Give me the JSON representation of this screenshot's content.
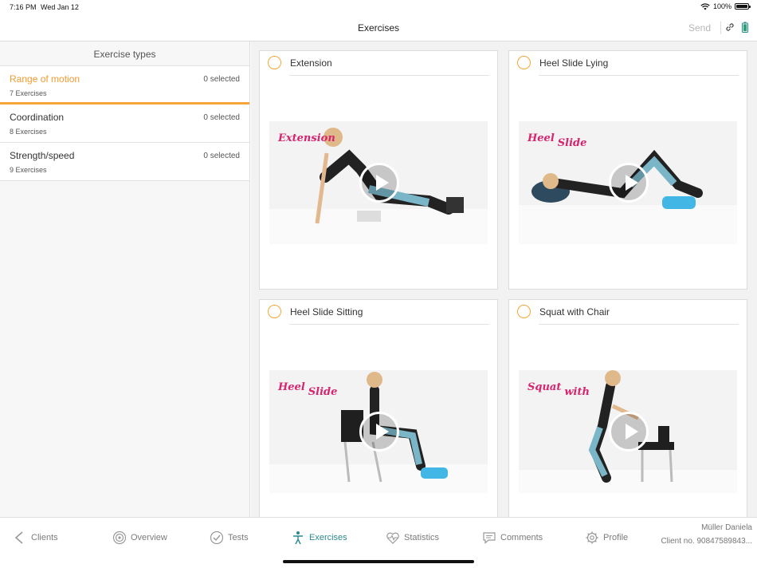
{
  "status_bar": {
    "time": "7:16 PM",
    "date": "Wed Jan 12",
    "battery_pct": "100%"
  },
  "nav": {
    "title": "Exercises",
    "send_label": "Send",
    "icons": [
      "link-icon",
      "battery-icon"
    ]
  },
  "sidebar": {
    "header": "Exercise types",
    "types": [
      {
        "name": "Range of motion",
        "count": "7 Exercises",
        "selected": "0 selected",
        "active": true
      },
      {
        "name": "Coordination",
        "count": "8 Exercises",
        "selected": "0 selected",
        "active": false
      },
      {
        "name": "Strength/speed",
        "count": "9 Exercises",
        "selected": "0 selected",
        "active": false
      }
    ]
  },
  "exercises": [
    {
      "title": "Extension",
      "overlay": "Extension",
      "overlay_sub": ""
    },
    {
      "title": "Heel Slide Lying",
      "overlay": "Heel",
      "overlay_sub": "Slide"
    },
    {
      "title": "Heel Slide Sitting",
      "overlay": "Heel",
      "overlay_sub": "Slide"
    },
    {
      "title": "Squat with Chair",
      "overlay": "Squat",
      "overlay_sub": "with"
    }
  ],
  "tabs": [
    {
      "label": "Clients",
      "icon": "chevron-left-icon"
    },
    {
      "label": "Overview",
      "icon": "spiral-icon"
    },
    {
      "label": "Tests",
      "icon": "check-circle-icon"
    },
    {
      "label": "Exercises",
      "icon": "figure-icon",
      "active": true
    },
    {
      "label": "Statistics",
      "icon": "heart-pulse-icon"
    },
    {
      "label": "Comments",
      "icon": "speech-bubble-icon"
    },
    {
      "label": "Profile",
      "icon": "gear-icon"
    }
  ],
  "client": {
    "name": "Müller Daniela",
    "number": "Client no. 90847589843..."
  },
  "colors": {
    "accent": "#f5a53a",
    "active_tab": "#2a8a8e",
    "overlay_text": "#d6246e"
  }
}
